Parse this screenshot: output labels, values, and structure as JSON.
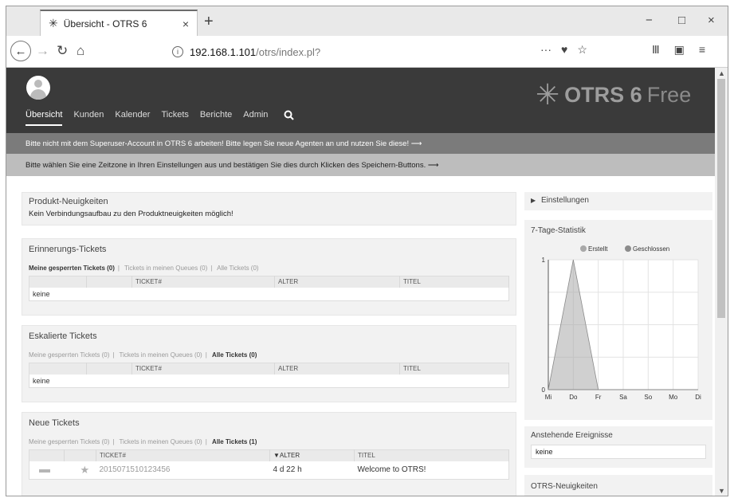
{
  "browser": {
    "tab_title": "Übersicht - OTRS 6",
    "tab_close": "×",
    "new_tab": "+",
    "url_host": "192.168.1.101",
    "url_path": "/otrs/index.pl?",
    "url_more": "···",
    "win_min": "−",
    "win_max": "□",
    "win_close": "×",
    "menu": "≡"
  },
  "header": {
    "nav": [
      "Übersicht",
      "Kunden",
      "Kalender",
      "Tickets",
      "Berichte",
      "Admin"
    ],
    "logo_brand": "OTRS 6",
    "logo_edition": "Free"
  },
  "notices": {
    "superuser": "Bitte nicht mit dem Superuser-Account in OTRS 6 arbeiten! Bitte legen Sie neue Agenten an und nutzen Sie diese! ⟶",
    "timezone": "Bitte wählen Sie eine Zeitzone in Ihren Einstellungen aus und bestätigen Sie dies durch Klicken des Speichern-Buttons. ⟶"
  },
  "product_news": {
    "title": "Produkt-Neuigkeiten",
    "message": "Kein Verbindungsaufbau zu den Produktneuigkeiten möglich!"
  },
  "reminder": {
    "title": "Erinnerungs-Tickets",
    "tabs": [
      "Meine gesperrten Tickets (0)",
      "Tickets in meinen Queues (0)",
      "Alle Tickets (0)"
    ],
    "columns": [
      "TICKET#",
      "ALTER",
      "TITEL"
    ],
    "empty": "keine"
  },
  "escalated": {
    "title": "Eskalierte Tickets",
    "tabs": [
      "Meine gesperrten Tickets (0)",
      "Tickets in meinen Queues (0)",
      "Alle Tickets (0)"
    ],
    "columns": [
      "TICKET#",
      "ALTER",
      "TITEL"
    ],
    "empty": "keine"
  },
  "new_tickets": {
    "title": "Neue Tickets",
    "tabs": [
      "Meine gesperrten Tickets (0)",
      "Tickets in meinen Queues (0)",
      "Alle Tickets (1)"
    ],
    "columns": [
      "TICKET#",
      "▼ALTER",
      "TITEL"
    ],
    "row": {
      "number": "2015071510123456",
      "age": "4 d 22 h",
      "title": "Welcome to OTRS!"
    }
  },
  "sidebar": {
    "settings": "Einstellungen",
    "stats_title": "7-Tage-Statistik",
    "events_title": "Anstehende Ereignisse",
    "events_empty": "keine",
    "news_title": "OTRS-Neuigkeiten"
  },
  "chart_data": {
    "type": "area",
    "title": "7-Tage-Statistik",
    "categories": [
      "Mi",
      "Do",
      "Fr",
      "Sa",
      "So",
      "Mo",
      "Di"
    ],
    "series": [
      {
        "name": "Erstellt",
        "values": [
          0,
          1,
          0,
          0,
          0,
          0,
          0
        ],
        "color": "#a9a9a9"
      },
      {
        "name": "Geschlossen",
        "values": [
          0,
          0,
          0,
          0,
          0,
          0,
          0
        ],
        "color": "#8c8c8c"
      }
    ],
    "ylim": [
      0,
      1
    ],
    "yticks": [
      "0",
      "1"
    ],
    "legend": "top-right",
    "grid": true
  }
}
